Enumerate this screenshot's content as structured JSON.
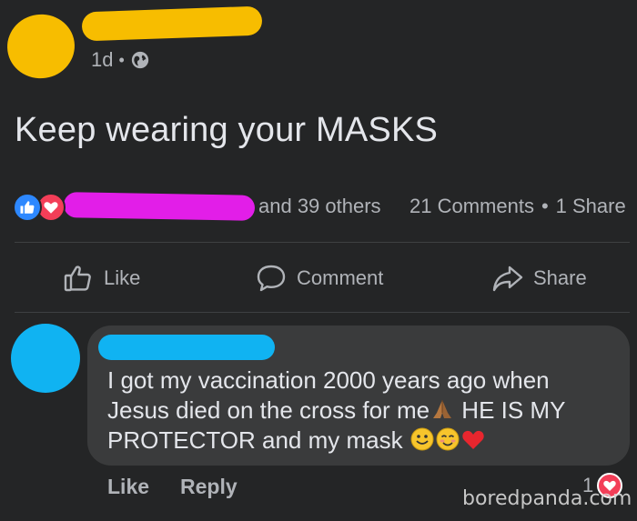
{
  "post": {
    "time": "1d",
    "separator": "•",
    "privacy_icon": "globe-icon",
    "text": "Keep wearing your MASKS"
  },
  "reactions": {
    "icons": [
      "like-icon",
      "love-icon"
    ],
    "others_text": "and 39 others",
    "comments_count": "21 Comments",
    "separator": "•",
    "shares_count": "1 Share"
  },
  "actions": {
    "like": "Like",
    "comment": "Comment",
    "share": "Share"
  },
  "comment": {
    "line1": "I got my vaccination 2000 years ago when",
    "line2a": "Jesus died on the cross for me",
    "line2b": "HE IS MY",
    "line3": "PROTECTOR and my mask",
    "like_label": "Like",
    "reply_label": "Reply",
    "reaction_count": "1"
  },
  "watermark": "boredpanda.com",
  "colors": {
    "background": "#242526",
    "bubble": "#3a3b3c",
    "like_blue": "#2d88ff",
    "love_red": "#f33e58",
    "redact_yellow": "#f7bd00",
    "redact_magenta": "#e21ee8",
    "redact_cyan": "#10b3f2"
  }
}
